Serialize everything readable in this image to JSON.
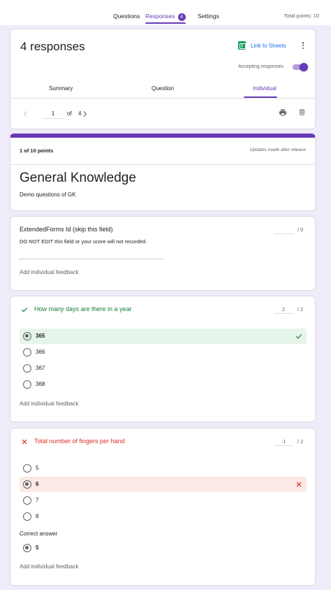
{
  "tabs": {
    "questions": "Questions",
    "responses": "Responses",
    "responses_count": "4",
    "settings": "Settings",
    "total_points": "Total points: 10"
  },
  "responses_card": {
    "title": "4 responses",
    "link_to_sheets": "Link to Sheets",
    "accepting_label": "Accepting responses",
    "accepting_on": true,
    "subtabs": [
      "Summary",
      "Question",
      "Individual"
    ],
    "active_subtab": "Individual",
    "page_current": "1",
    "page_of": "of",
    "page_total": "4"
  },
  "form": {
    "score": "1 of 10 points",
    "updates_note": "Updates made after release",
    "title": "General Knowledge",
    "description": "Demo questions of GK"
  },
  "questions": [
    {
      "title": "ExtendedForms Id (skip this field)",
      "note": "DO NOT EDIT this field or your score will not recorded.",
      "points_given": "",
      "points_max": "/ 0",
      "feedback": "Add individual feedback"
    },
    {
      "title": "How many days are there in a year",
      "status": "correct",
      "points_given": "2",
      "points_max": "/ 2",
      "options": [
        "365",
        "366",
        "367",
        "368"
      ],
      "selected": "365",
      "feedback": "Add individual feedback"
    },
    {
      "title": "Total number of fingers per hand",
      "status": "wrong",
      "points_given": "-1",
      "points_max": "/ 2",
      "options": [
        "5",
        "6",
        "7",
        "8"
      ],
      "selected": "6",
      "correct_answer_label": "Correct answer",
      "correct_answer": "5",
      "feedback": "Add individual feedback"
    }
  ],
  "colors": {
    "accent": "#673ab7",
    "correct": "#188038",
    "wrong": "#d93025",
    "link": "#1a73e8",
    "background": "#f0ebf8"
  },
  "icons": [
    "sheets-icon",
    "more-vert-icon",
    "chevron-left-icon",
    "chevron-right-icon",
    "print-icon",
    "delete-icon",
    "check-icon",
    "close-icon"
  ]
}
